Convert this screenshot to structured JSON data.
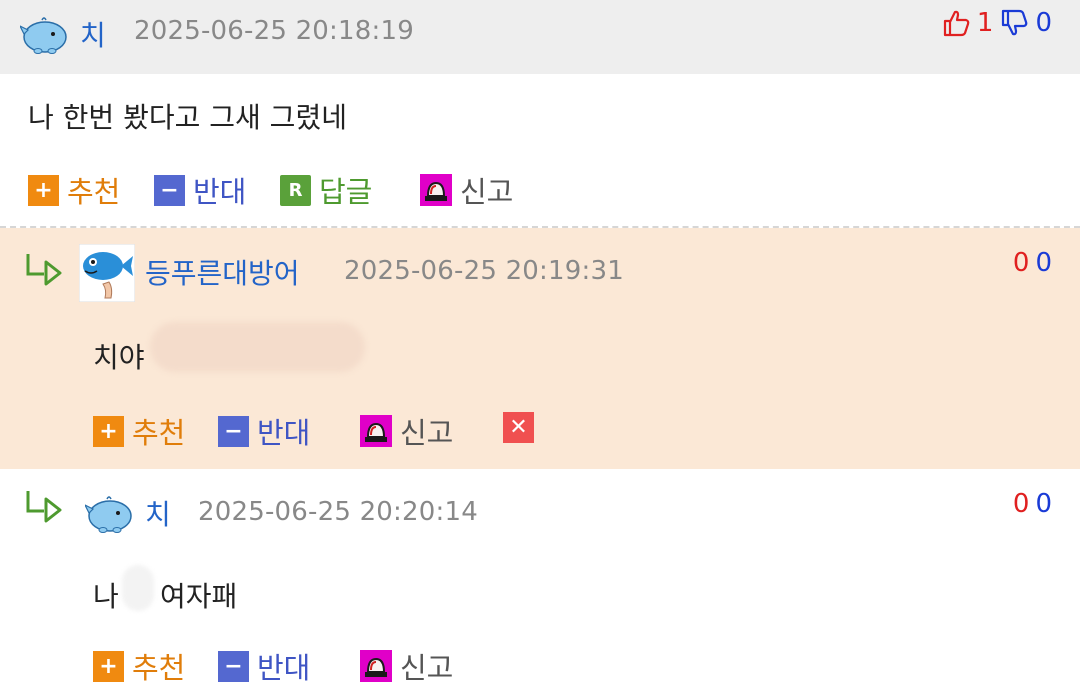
{
  "comments": [
    {
      "nickname": "치",
      "time": "2025-06-25 20:18:19",
      "body": "나 한번 봤다고 그새 그렸네",
      "votes": {
        "up": "1",
        "down": "0"
      },
      "actions": {
        "recommend": "추천",
        "oppose": "반대",
        "reply": "답글",
        "report": "신고"
      },
      "icons": {
        "reply_badge": "R"
      }
    },
    {
      "nickname": "등푸른대방어",
      "time": "2025-06-25 20:19:31",
      "body": "치야",
      "votes": {
        "up": "0",
        "down": "0"
      },
      "actions": {
        "recommend": "추천",
        "oppose": "반대",
        "report": "신고"
      }
    },
    {
      "nickname": "치",
      "time": "2025-06-25 20:20:14",
      "body_before": "나",
      "body_after": "여자패",
      "votes": {
        "up": "0",
        "down": "0"
      },
      "actions": {
        "recommend": "추천",
        "oppose": "반대",
        "report": "신고"
      }
    }
  ],
  "colors": {
    "header_bg": "#eeeeee",
    "highlight_bg": "#fbe8d6",
    "nickname": "#2364c8",
    "timestamp": "#888888",
    "recommend": "#e07d0a",
    "oppose": "#3f55c4",
    "reply": "#4e9a2f",
    "report_icon": "#e000c8",
    "delete_icon": "#f05050",
    "vote_up": "#e02020",
    "vote_down": "#1a3bd6"
  },
  "icon_names": [
    "whale-avatar-icon",
    "fish-avatar-icon",
    "thumbs-up-icon",
    "thumbs-down-icon",
    "reply-arrow-icon",
    "plus-icon",
    "minus-icon",
    "siren-icon",
    "close-icon"
  ]
}
